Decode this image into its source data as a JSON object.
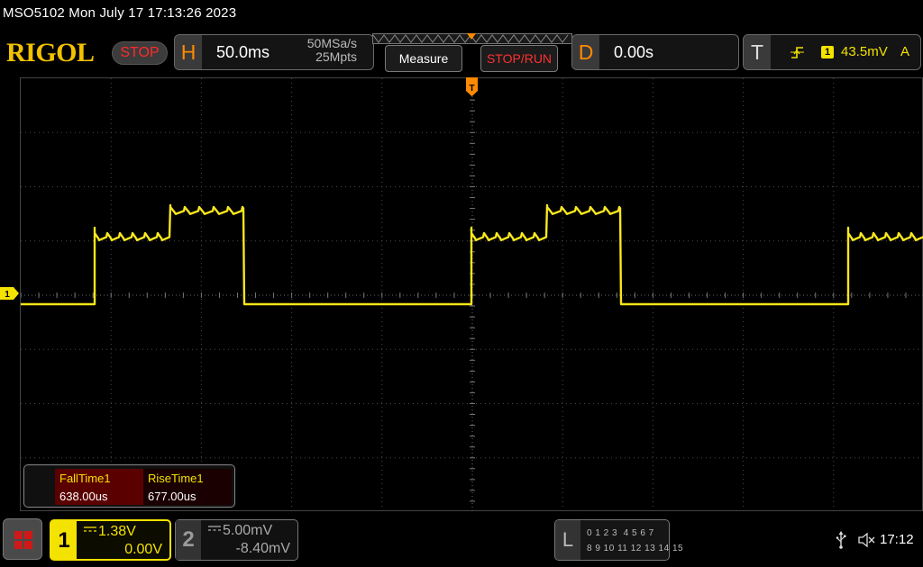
{
  "status": {
    "text": "MSO5102  Mon July 17 17:13:26 2023"
  },
  "brand": {
    "logo": "RIGOL",
    "run_state": "STOP"
  },
  "horizontal": {
    "letter": "H",
    "timebase": "50.0ms",
    "sample_rate": "50MSa/s",
    "memory_depth": "25Mpts"
  },
  "buttons": {
    "measure": "Measure",
    "stop_run": "STOP/RUN"
  },
  "delay": {
    "letter": "D",
    "value": "0.00s"
  },
  "trigger": {
    "letter": "T",
    "edge_icon": "rising-edge-icon",
    "source": "1",
    "level": "43.5mV",
    "mode": "A"
  },
  "measurements": [
    {
      "name": "FallTime1",
      "value": "638.00us"
    },
    {
      "name": "RiseTime1",
      "value": "677.00us"
    }
  ],
  "channel1": {
    "number": "1",
    "coupling": "DC",
    "scale": "1.38V",
    "offset": "0.00V",
    "color": "#f4e200"
  },
  "channel2": {
    "number": "2",
    "coupling": "DC",
    "scale": "5.00mV",
    "offset": "-8.40mV",
    "color": "#aaaaaa"
  },
  "logic_analyzer": {
    "letter": "L",
    "row1": "0 1 2 3  4 5 6 7",
    "row2": "8 9 10 11 12 13 14 15"
  },
  "clock": "17:12",
  "icons": {
    "usb": "usb-icon",
    "speaker": "speaker-muted-icon",
    "home": "home-menu-icon"
  },
  "waveform": {
    "markers": {
      "channel": "1",
      "trigger": "T"
    }
  }
}
